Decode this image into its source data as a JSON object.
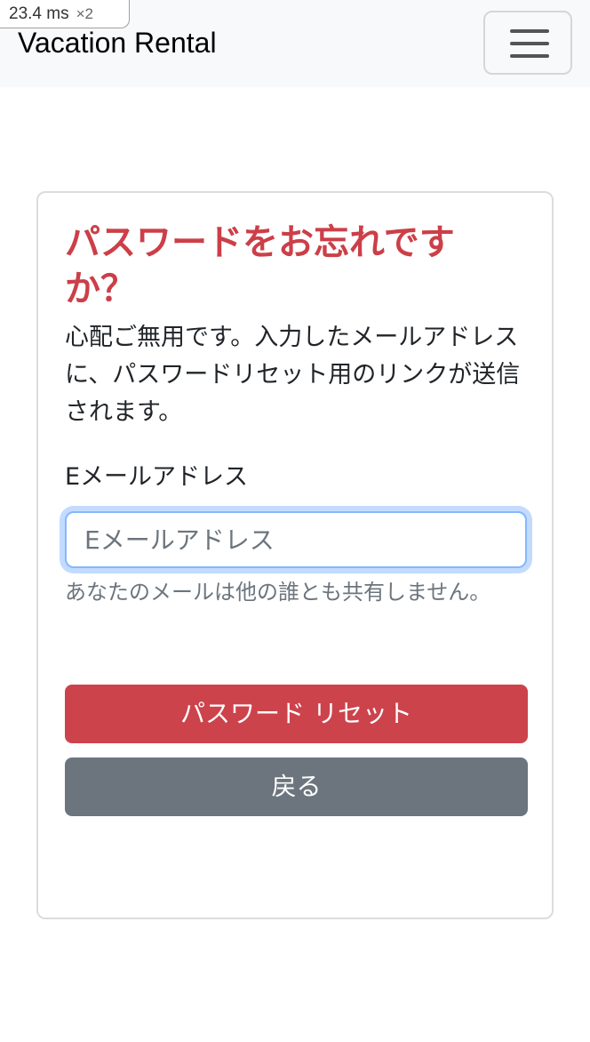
{
  "navbar": {
    "brand": "Vacation Rental",
    "toggler_icon": "hamburger-menu-icon"
  },
  "perf_badge": {
    "time": "23.4 ms",
    "multiplier": "×2"
  },
  "card": {
    "title": "パスワードをお忘れですか？",
    "description": "心配ご無用です。入力したメールアドレスに、パスワードリセット用のリンクが送信されます。",
    "email_label": "Eメールアドレス",
    "email_placeholder": "Eメールアドレス",
    "email_value": "",
    "help_text": "あなたのメールは他の誰とも共有しません。",
    "reset_button": "パスワード リセット",
    "back_button": "戻る"
  },
  "colors": {
    "title": "#cc3f48",
    "reset_button": "#cc434c",
    "back_button": "#6c757d",
    "navbar_bg": "#f8f9fa",
    "input_focus_border": "#86b7fe"
  }
}
